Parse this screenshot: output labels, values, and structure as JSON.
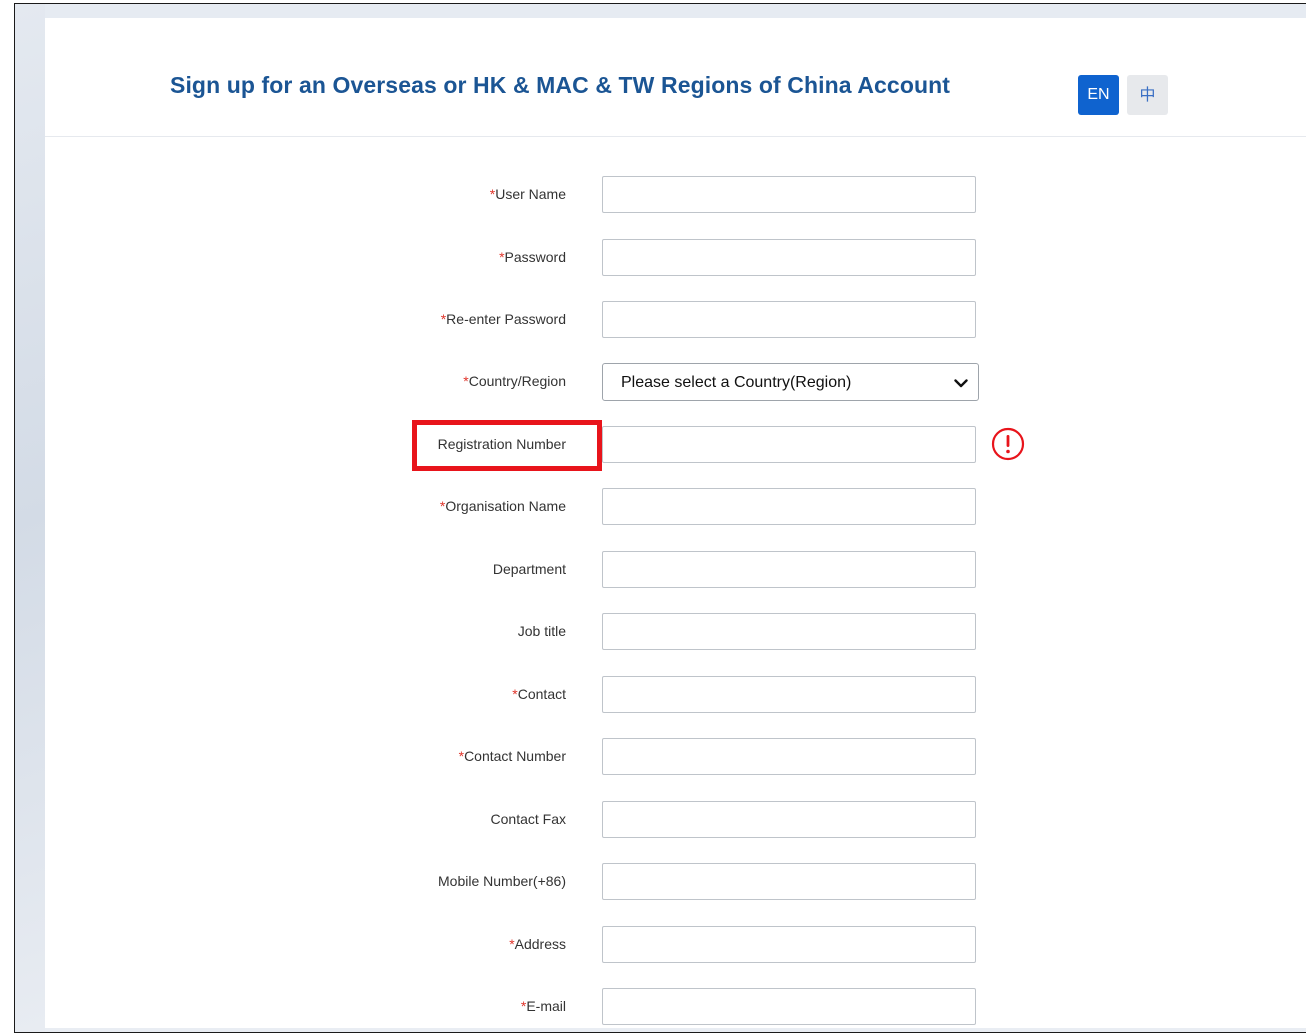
{
  "header": {
    "title": "Sign up for an Overseas or HK & MAC & TW Regions of China Account",
    "lang_en": "EN",
    "lang_zh": "中"
  },
  "form": {
    "required_mark": "*",
    "fields": [
      {
        "label": "User Name",
        "required": true,
        "type": "text",
        "value": ""
      },
      {
        "label": "Password",
        "required": true,
        "type": "password",
        "value": ""
      },
      {
        "label": "Re-enter Password",
        "required": true,
        "type": "password",
        "value": ""
      },
      {
        "label": "Country/Region",
        "required": true,
        "type": "select",
        "selected": "Please select a Country(Region)"
      },
      {
        "label": "Registration Number",
        "required": false,
        "type": "text",
        "value": "",
        "highlighted": true,
        "alert": true
      },
      {
        "label": "Organisation Name",
        "required": true,
        "type": "text",
        "value": ""
      },
      {
        "label": "Department",
        "required": false,
        "type": "text",
        "value": ""
      },
      {
        "label": "Job title",
        "required": false,
        "type": "text",
        "value": ""
      },
      {
        "label": "Contact",
        "required": true,
        "type": "text",
        "value": ""
      },
      {
        "label": "Contact Number",
        "required": true,
        "type": "text",
        "value": ""
      },
      {
        "label": "Contact Fax",
        "required": false,
        "type": "text",
        "value": ""
      },
      {
        "label": "Mobile Number(+86)",
        "required": false,
        "type": "text",
        "value": ""
      },
      {
        "label": "Address",
        "required": true,
        "type": "text",
        "value": ""
      },
      {
        "label": "E-mail",
        "required": true,
        "type": "text",
        "value": ""
      }
    ]
  },
  "colors": {
    "title": "#1b5594",
    "required_mark": "#e0352b",
    "lang_active_bg": "#0f63cf",
    "lang_inactive_bg": "#e7e9ec",
    "highlight_border": "#e8141b",
    "alert": "#e8141b"
  },
  "icons": {
    "select_arrow": "chevron-down-icon",
    "field_alert": "exclamation-circle-icon"
  }
}
